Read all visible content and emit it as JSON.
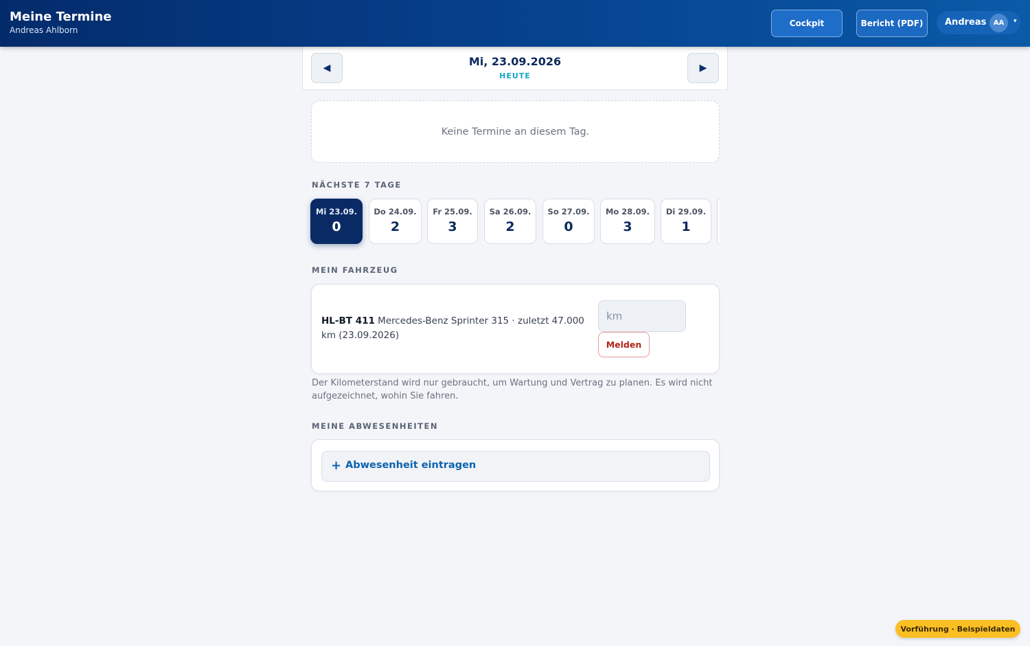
{
  "header": {
    "title": "Meine Termine",
    "subtitle": "Andreas Ahlborn",
    "cockpit_label": "Cockpit",
    "report_label": "Bericht (PDF)",
    "user_name": "Andreas",
    "user_initials": "AA",
    "user_caret": "▾"
  },
  "date_nav": {
    "prev_icon": "◀",
    "next_icon": "▶",
    "date": "Mi, 23.09.2026",
    "today": "HEUTE"
  },
  "empty_message": "Keine Termine an diesem Tag.",
  "next_days": {
    "title": "NÄCHSTE 7 TAGE",
    "days": [
      {
        "date": "Mi 23.09.",
        "count": "0"
      },
      {
        "date": "Do 24.09.",
        "count": "2"
      },
      {
        "date": "Fr 25.09.",
        "count": "3"
      },
      {
        "date": "Sa 26.09.",
        "count": "2"
      },
      {
        "date": "So 27.09.",
        "count": "0"
      },
      {
        "date": "Mo 28.09.",
        "count": "3"
      },
      {
        "date": "Di 29.09.",
        "count": "1"
      }
    ]
  },
  "vehicle": {
    "title": "MEIN FAHRZEUG",
    "plate": "HL-BT 411",
    "description": " Mercedes-Benz Sprinter 315 · zuletzt 47.000 km (23.09.2026)",
    "km_placeholder": "km",
    "submit_label": "Melden",
    "note": "Der Kilometerstand wird nur gebraucht, um Wartung und Vertrag zu planen. Es wird nicht aufgezeichnet, wohin Sie fahren."
  },
  "absences": {
    "title": "MEINE ABWESENHEITEN",
    "plus_icon": "+",
    "add_label": "Abwesenheit eintragen"
  },
  "demo_badge": "Vorführung · Beispieldaten",
  "colors": {
    "header": "#06418d",
    "active_day": "#0a2a66",
    "today_accent": "#14a6c6",
    "link": "#0b63b0",
    "danger": "#b42318",
    "badge": "#fbbf24"
  }
}
